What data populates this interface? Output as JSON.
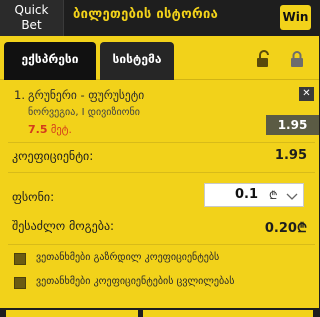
{
  "header": {
    "quick_bet_line1": "Quick",
    "quick_bet_line2": "Bet",
    "title": "ბილეთების ისტორია",
    "win_label": "Win"
  },
  "tabs": [
    {
      "label": "ექსპრესი",
      "active": true
    },
    {
      "label": "სისტემა",
      "active": false
    }
  ],
  "bet": {
    "index": "1.",
    "match": "გრუნერი - ფურუსეტი",
    "league": "ნორვეგია, I დივიზიონი",
    "minute_value": "7.5",
    "minute_unit": "მეტ.",
    "odd": "1.95",
    "close_label": "✕"
  },
  "summary": {
    "coef_label": "კოეფიციენტი:",
    "coef_value": "1.95",
    "stake_label": "ფსონი:",
    "stake_value": "0.1",
    "currency": "₾",
    "possible_win_label": "შესაძლო მოგება:",
    "possible_win_value": "0.20₾"
  },
  "options": [
    {
      "label": "ვეთანხმები გაზრდილ კოეფიციენტებს"
    },
    {
      "label": "ვეთანხმები კოეფიციენტების ცვლილებას"
    }
  ],
  "colors": {
    "accent": "#f2d21a",
    "dark": "#1e1e1e",
    "minute_red": "#d43b1c",
    "odd_box": "#5b5b44"
  }
}
